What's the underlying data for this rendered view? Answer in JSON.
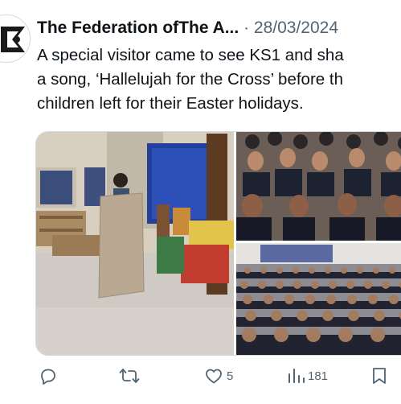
{
  "tweet": {
    "author": "The Federation ofThe A...",
    "separator": "·",
    "date": "28/03/2024",
    "text_lines": [
      "A special visitor came to see KS1 and sha",
      "a song, ‘Hallelujah for the Cross’ before th",
      "children left for their Easter holidays."
    ]
  },
  "actions": {
    "reply_icon": "reply-icon",
    "retweet_icon": "retweet-icon",
    "like_icon": "heart-icon",
    "likes": "5",
    "views_icon": "views-icon",
    "views": "181",
    "bookmark_icon": "bookmark-icon"
  },
  "colors": {
    "text": "#0f1419",
    "secondary": "#536471",
    "border": "#cfd9de"
  }
}
